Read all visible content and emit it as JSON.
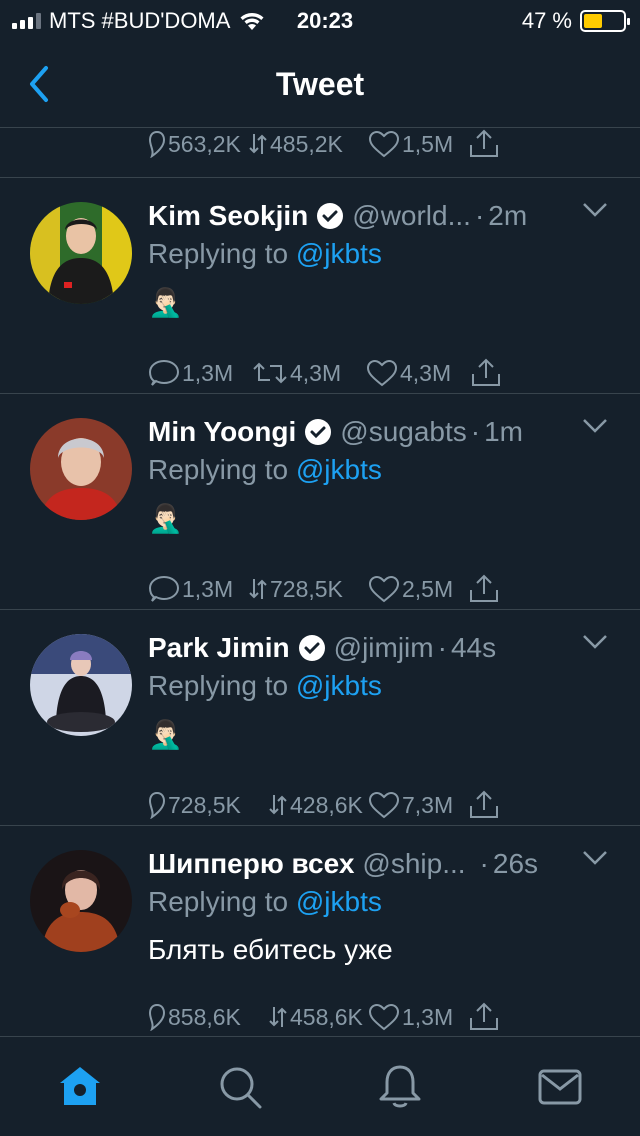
{
  "status_bar": {
    "carrier": "MTS #BUD'DOMA",
    "time": "20:23",
    "battery": "47 %",
    "battery_level": 0.47
  },
  "nav": {
    "title": "Tweet",
    "back_icon": "chevron-left-icon"
  },
  "top_actions": {
    "replies": "563,2K",
    "retweets": "485,2K",
    "likes": "1,5M"
  },
  "tweets": [
    {
      "name": "Kim Seokjin",
      "handle": "@world...",
      "time": "2m",
      "replying_prefix": "Replying to",
      "replying_to": "@jkbts",
      "content": "🤦🏻‍♂️",
      "replies": "1,3M",
      "retweets": "4,3M",
      "likes": "4,3M"
    },
    {
      "name": "Min Yoongi",
      "handle": "@sugabts",
      "time": "1m",
      "replying_prefix": "Replying to",
      "replying_to": "@jkbts",
      "content": "🤦🏻‍♂️",
      "replies": "1,3M",
      "retweets": "728,5K",
      "likes": "2,5M"
    },
    {
      "name": "Park Jimin",
      "handle": "@jimjim",
      "time": "44s",
      "replying_prefix": "Replying to",
      "replying_to": "@jkbts",
      "content": "🤦🏻‍♂️",
      "replies": "728,5K",
      "retweets": "428,6K",
      "likes": "7,3M"
    },
    {
      "name": "Шипперю всех",
      "handle": "@ship...",
      "time": "26s",
      "replying_prefix": "Replying to",
      "replying_to": "@jkbts",
      "content": "Блять ебитесь уже",
      "replies": "858,6K",
      "retweets": "458,6K",
      "likes": "1,3M"
    }
  ],
  "tab_bar": {
    "tabs": [
      "home-icon",
      "search-icon",
      "notifications-icon",
      "messages-icon"
    ],
    "active_color": "#1da1f2",
    "inactive_color": "#8899a6"
  },
  "colors": {
    "background": "#15202b",
    "divider": "#38444d",
    "accent": "#1da1f2",
    "secondary_text": "#8899a6"
  }
}
